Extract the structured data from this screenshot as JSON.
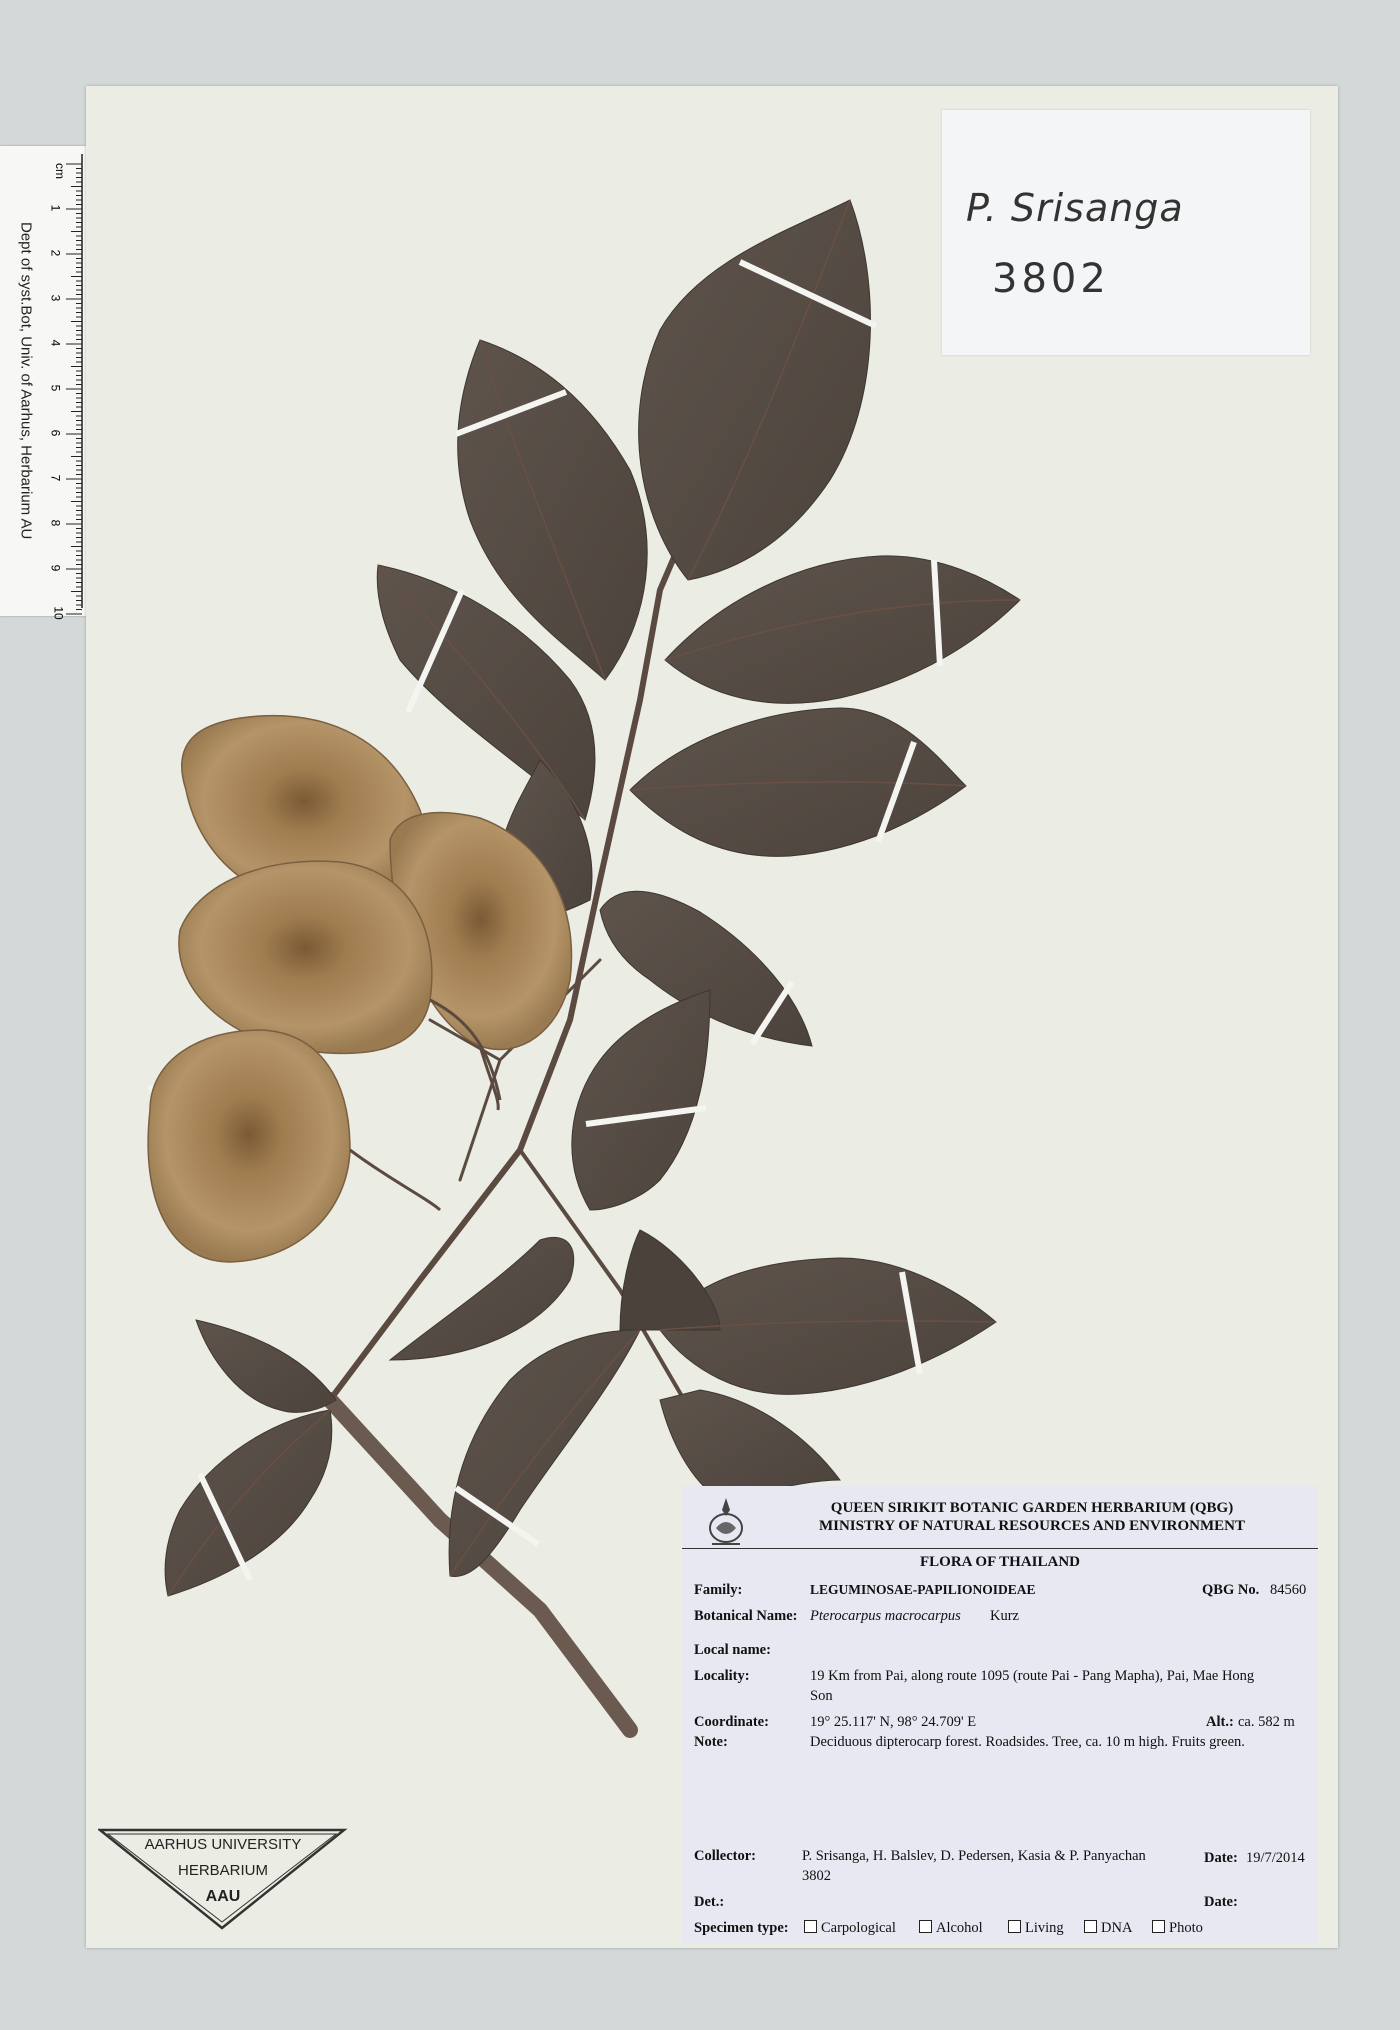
{
  "ruler": {
    "unit": "cm",
    "ticks": [
      "1",
      "2",
      "3",
      "4",
      "5",
      "6",
      "7",
      "8",
      "9",
      "10"
    ],
    "caption": "Dept of syst.Bot, Univ. of Aarhus, Herbarium AU"
  },
  "collector_note": {
    "name": "P. Srisanga",
    "number": "3802"
  },
  "label": {
    "institution_line1": "QUEEN SIRIKIT BOTANIC GARDEN HERBARIUM (QBG)",
    "institution_line2": "MINISTRY OF NATURAL RESOURCES AND ENVIRONMENT",
    "flora": "FLORA OF THAILAND",
    "family_label": "Family:",
    "family_value": "LEGUMINOSAE-PAPILIONOIDEAE",
    "qbg_label": "QBG No.",
    "qbg_value": "84560",
    "botanical_label": "Botanical Name:",
    "botanical_value": "Pterocarpus macrocarpus",
    "botanical_author": "Kurz",
    "local_label": "Local name:",
    "locality_label": "Locality:",
    "locality_line1": "19 Km from Pai, along route 1095 (route Pai - Pang Mapha),  Pai, Mae Hong",
    "locality_line2": "Son",
    "coordinate_label": "Coordinate:",
    "coordinate_value": "19° 25.117' N, 98° 24.709' E",
    "alt_label": "Alt.:",
    "alt_value": "ca. 582 m",
    "note_label": "Note:",
    "note_value": "Deciduous dipterocarp forest.  Roadsides.  Tree, ca. 10 m high.  Fruits green.",
    "collector_label": "Collector:",
    "collector_line1": "P. Srisanga, H. Balslev, D. Pedersen, Kasia & P. Panyachan",
    "collector_line2": "3802",
    "date_label": "Date:",
    "date_value": "19/7/2014",
    "det_label": "Det.:",
    "date2_label": "Date:",
    "specimen_type_label": "Specimen type:",
    "specimen_types": [
      "Carpological",
      "Alcohol",
      "Living",
      "DNA",
      "Photo"
    ]
  },
  "stamp": {
    "line1": "AARHUS UNIVERSITY",
    "line2": "HERBARIUM",
    "line3": "AAU"
  },
  "colors": {
    "background": "#d3d8d9",
    "sheet": "#ebece4",
    "leaf": "#574d45",
    "fruit": "#ad9066",
    "label_bg": "#e7e8f1"
  }
}
